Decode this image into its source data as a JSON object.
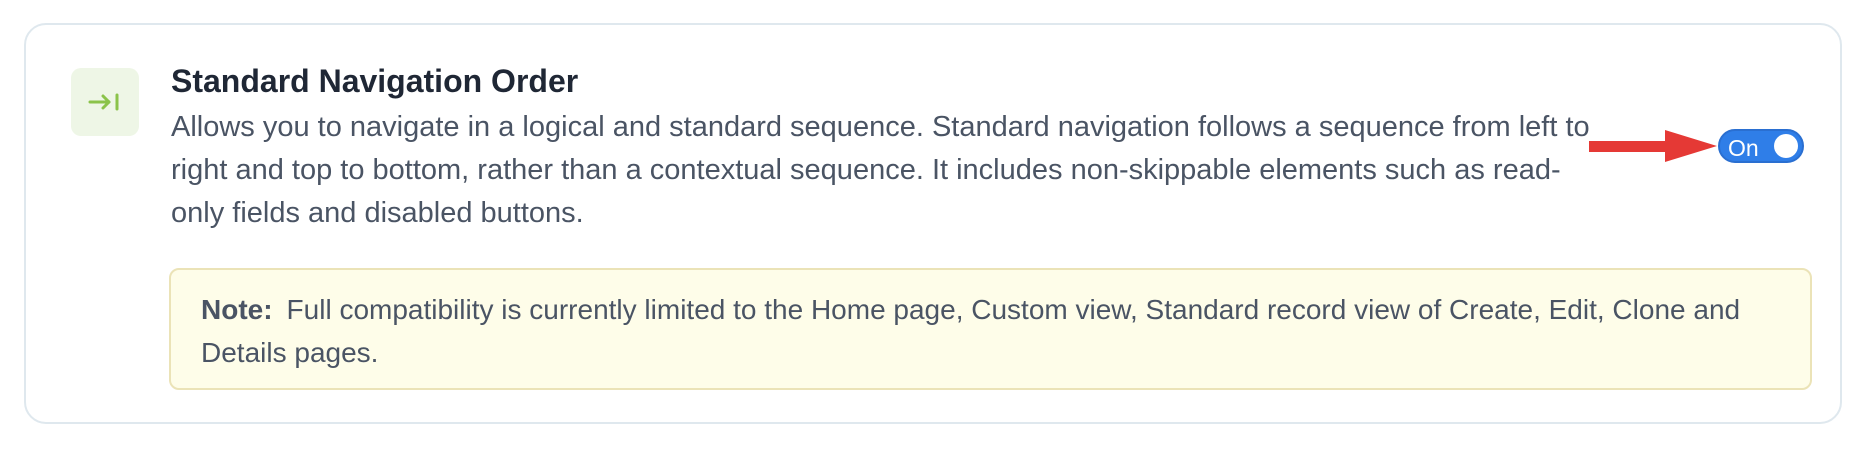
{
  "setting": {
    "icon": "arrow-right-to-bar-icon",
    "title": "Standard Navigation Order",
    "description": "Allows you to navigate in a logical and standard sequence. Standard navigation follows a sequence from left to right and top to bottom, rather than a contextual sequence. It includes non-skippable elements such as read-only fields and disabled buttons.",
    "toggle": {
      "label": "On",
      "state": "on"
    }
  },
  "note": {
    "label": "Note:",
    "text": "Full compatibility is currently limited to the Home page, Custom view, Standard record view of Create, Edit, Clone and Details pages."
  },
  "annotation": {
    "type": "red-arrow-icon",
    "color": "#e53935"
  },
  "colors": {
    "toggle_on": "#2f7ee8",
    "icon_accent": "#8bc34a",
    "icon_bg": "#eef6e6",
    "note_bg": "#fefde9",
    "note_border": "#ebe3b7"
  }
}
